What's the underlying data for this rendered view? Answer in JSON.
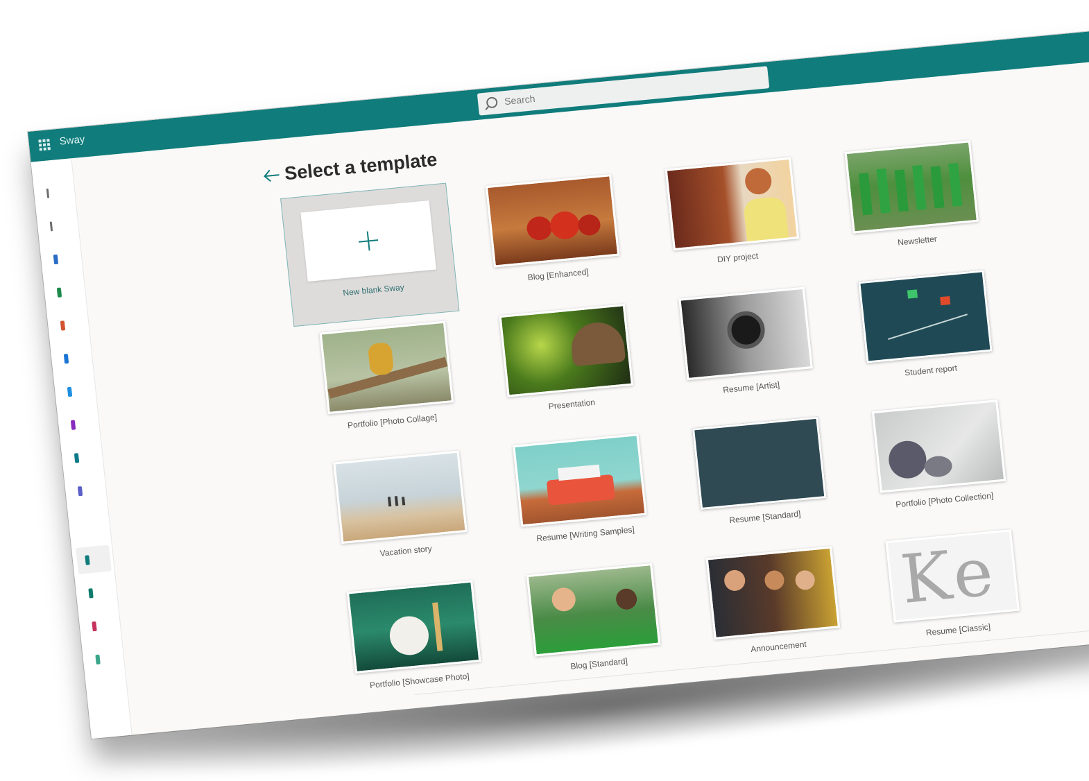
{
  "app": {
    "name": "Sway"
  },
  "search": {
    "placeholder": "Search"
  },
  "page": {
    "title": "Select a template"
  },
  "templates": [
    {
      "label": "New blank Sway"
    },
    {
      "label": "Blog [Enhanced]"
    },
    {
      "label": "DIY project"
    },
    {
      "label": "Newsletter"
    },
    {
      "label": "Portfolio [Photo Collage]"
    },
    {
      "label": "Presentation"
    },
    {
      "label": "Resume [Artist]"
    },
    {
      "label": "Student report"
    },
    {
      "label": "Vacation story"
    },
    {
      "label": "Resume [Writing Samples]"
    },
    {
      "label": "Resume [Standard]"
    },
    {
      "label": "Portfolio [Photo Collection]"
    },
    {
      "label": "Portfolio [Showcase Photo]"
    },
    {
      "label": "Blog [Standard]"
    },
    {
      "label": "Announcement"
    },
    {
      "label": "Resume [Classic]"
    }
  ],
  "classic_thumb_text": "Ke",
  "colors": {
    "accent": "#107c7b",
    "background": "#faf9f8"
  },
  "icons": [
    "waffle-icon",
    "search-icon",
    "back-arrow-icon",
    "plus-icon"
  ]
}
